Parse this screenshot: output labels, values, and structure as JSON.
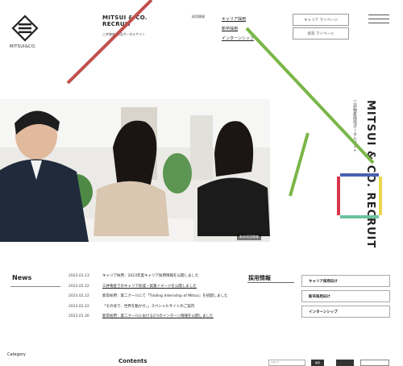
{
  "header": {
    "logo_text": "MITSUI&CO.",
    "site_title_line1": "MITSUI & CO.",
    "site_title_line2": "RECRUIT",
    "site_subtitle": "三井物産 採用ポータルサイト",
    "nav_heading": "採用情報",
    "nav_links": [
      "キャリア採用",
      "新卒採用",
      "インターンシップ"
    ],
    "btn_career_mypage": "キャリア マイページ",
    "btn_new_mypage": "新卒 マイページ"
  },
  "hero": {
    "caption": "新卒採用情報",
    "vertical_title": "MITSUI & CO. RECRUIT",
    "vertical_subtitle": "三井物産採用ポータルサイト"
  },
  "news": {
    "title": "News",
    "items": [
      {
        "date": "2023.03.13",
        "text": "キャリア採用：2023年度キャリア採用情報を公開しました",
        "link": false
      },
      {
        "date": "2023.02.22",
        "text": "三井物産でのキャリア形成・就業イメージを公開しました",
        "link": true
      },
      {
        "date": "2023.02.22",
        "text": "新卒採用：第二クールにて「Trading Internship of Mitsui」を初開しました",
        "link": false
      },
      {
        "date": "2023.02.22",
        "text": "「その背で、世界を動かせ。」スペシャルサイトのご案内",
        "link": false
      },
      {
        "date": "2023.01.30",
        "text": "新卒採用：第二クールにおける2つのインターン情報を公開しました",
        "link": true
      }
    ]
  },
  "recruit": {
    "title": "採用情報",
    "buttons": [
      "キャリア採用向け",
      "新卒採用向け",
      "インターンシップ"
    ]
  },
  "footer": {
    "category_label": "Category",
    "contents_label": "Contents",
    "search_placeholder": "search",
    "search_btn": "検索",
    "btn_2": "",
    "btn_3": ""
  },
  "colors": {
    "red_line": "#c0504d",
    "green_line": "#7ab648",
    "square_blue": "#4a62b0",
    "square_yellow": "#e8d84a",
    "square_green": "#6cc3a0",
    "square_red": "#d6364a"
  }
}
